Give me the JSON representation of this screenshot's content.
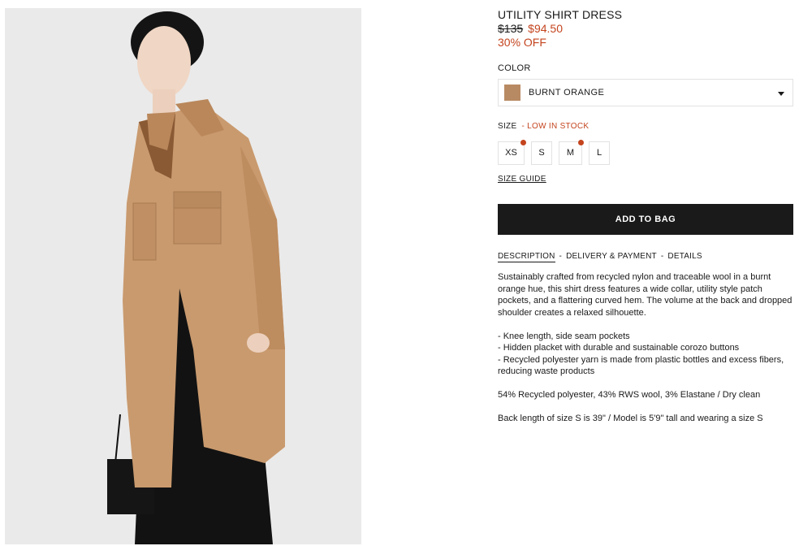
{
  "product": {
    "title": "UTILITY SHIRT DRESS",
    "price_original": "$135",
    "price_sale": "$94.50",
    "discount": "30% OFF"
  },
  "color": {
    "label": "COLOR",
    "selected": "BURNT ORANGE",
    "swatch_color": "#b88a63"
  },
  "size": {
    "label": "SIZE",
    "stock_note": "- LOW IN STOCK",
    "options": [
      {
        "label": "XS",
        "low_stock": true
      },
      {
        "label": "S",
        "low_stock": false
      },
      {
        "label": "M",
        "low_stock": true
      },
      {
        "label": "L",
        "low_stock": false
      }
    ],
    "guide_label": "SIZE GUIDE"
  },
  "add_to_bag_label": "ADD TO BAG",
  "tabs": [
    {
      "label": "DESCRIPTION",
      "active": true
    },
    {
      "label": "DELIVERY & PAYMENT",
      "active": false
    },
    {
      "label": "DETAILS",
      "active": false
    }
  ],
  "tab_separator": "-",
  "description": {
    "intro": "Sustainably crafted from recycled nylon and traceable wool in a burnt orange hue, this shirt dress features a wide collar, utility style patch pockets, and a flattering curved hem. The volume at the back and dropped shoulder creates a relaxed silhouette.",
    "bullets": [
      "- Knee length, side seam pockets",
      "- Hidden placket with durable and sustainable corozo buttons",
      "- Recycled polyester yarn is made from plastic bottles and excess fibers, reducing waste products"
    ],
    "composition": "54% Recycled polyester, 43% RWS wool, 3% Elastane / Dry clean",
    "fit": "Back length of size S is 39\" / Model is 5'9\" tall and wearing a size S"
  },
  "colors": {
    "accent_red": "#c4441e",
    "dress": "#c99a6e",
    "button_bg": "#1a1a1a"
  }
}
